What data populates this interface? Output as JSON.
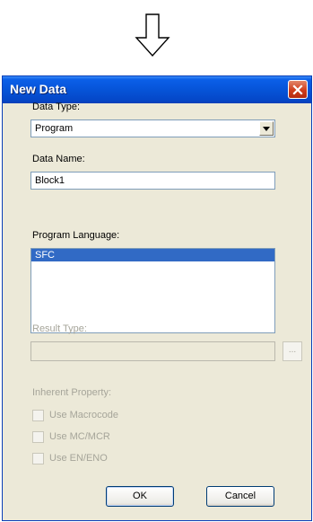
{
  "dialog": {
    "title": "New Data",
    "close_icon": "close-icon"
  },
  "data_type": {
    "label": "Data Type:",
    "selected": "Program"
  },
  "data_name": {
    "label": "Data Name:",
    "value": "Block1"
  },
  "program_language": {
    "label": "Program Language:",
    "items": [
      "SFC"
    ],
    "selected_index": 0
  },
  "result_type": {
    "label": "Result Type:",
    "value": "",
    "browse_label": "..."
  },
  "inherent_property": {
    "label": "Inherent Property:",
    "options": [
      {
        "label": "Use Macrocode",
        "checked": false
      },
      {
        "label": "Use MC/MCR",
        "checked": false
      },
      {
        "label": "Use EN/ENO",
        "checked": false
      }
    ]
  },
  "buttons": {
    "ok": "OK",
    "cancel": "Cancel"
  },
  "colors": {
    "titlebar": "#0654d8",
    "selection": "#316ac5",
    "close": "#cf3d1c"
  }
}
